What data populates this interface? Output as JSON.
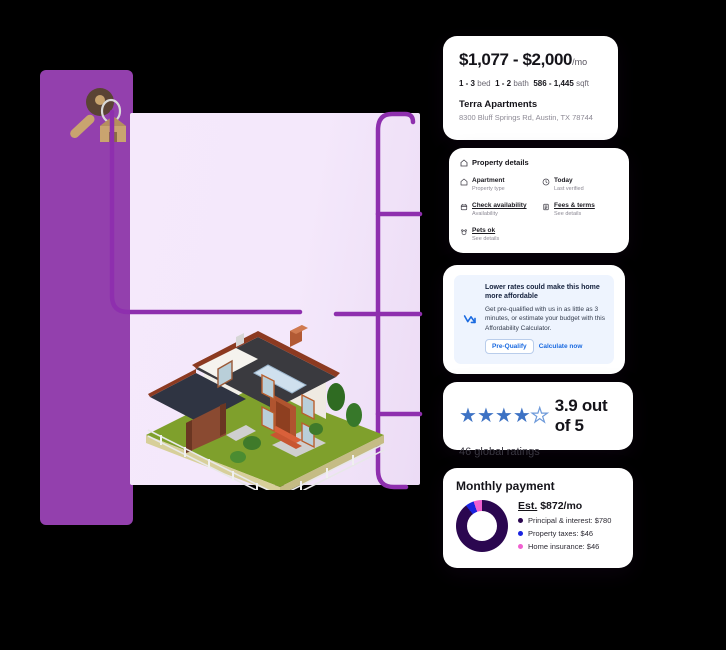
{
  "colors": {
    "purple_bar": "#9340ad",
    "lavender_panel": "#f4e8fb",
    "connector": "#8e2fae",
    "accent_blue": "#1a6ae0",
    "star_blue": "#3d72c4",
    "donut_principal": "#2b0750",
    "donut_taxes": "#1a23e0",
    "donut_insurance": "#f060d0"
  },
  "emblem": {
    "key_icon": "house-key-icon",
    "panel_name": "purple-accent-bar"
  },
  "house": {
    "illustration_name": "isometric-house-illustration"
  },
  "price_card": {
    "price_range": "$1,077 - $2,000",
    "per_unit": "/mo",
    "spec_bed_value": "1 - 3",
    "spec_bed_label": "bed",
    "spec_bath_value": "1 - 2",
    "spec_bath_label": "bath",
    "spec_sqft_value": "586 - 1,445",
    "spec_sqft_label": "sqft",
    "property_name": "Terra Apartments",
    "address": "8300 Bluff Springs Rd, Austin, TX 78744"
  },
  "details_card": {
    "header": "Property details",
    "header_icon": "home-icon",
    "items": [
      {
        "icon": "home-icon",
        "title": "Apartment",
        "subtitle": "Property type",
        "link": false
      },
      {
        "icon": "clock-icon",
        "title": "Today",
        "subtitle": "Last verified",
        "link": false
      },
      {
        "icon": "calendar-icon",
        "title": "Check availability",
        "subtitle": "Availability",
        "link": true
      },
      {
        "icon": "document-icon",
        "title": "Fees & terms",
        "subtitle": "See details",
        "link": true
      },
      {
        "icon": "paw-icon",
        "title": "Pets ok",
        "subtitle": "See details",
        "link": true
      }
    ]
  },
  "affordability_card": {
    "icon": "rate-down-arrow-icon",
    "title": "Lower rates could make this home more affordable",
    "body": "Get pre-qualified with us in as little as 3 minutes, or estimate your budget with this Affordability Calculator.",
    "primary_button": "Pre-Qualify",
    "secondary_link": "Calculate now"
  },
  "ratings_card": {
    "stars_filled": 4,
    "stars_total": 5,
    "rating_text": "3.9 out of 5",
    "global_ratings": "46 global ratings"
  },
  "payment_card": {
    "title": "Monthly payment",
    "est_prefix": "Est.",
    "est_amount": "$872/mo",
    "legend": [
      {
        "label": "Principal & interest: $780",
        "color": "#2b0750",
        "value": 780
      },
      {
        "label": "Property taxes: $46",
        "color": "#1a23e0",
        "value": 46
      },
      {
        "label": "Home insurance: $46",
        "color": "#f060d0",
        "value": 46
      }
    ]
  }
}
